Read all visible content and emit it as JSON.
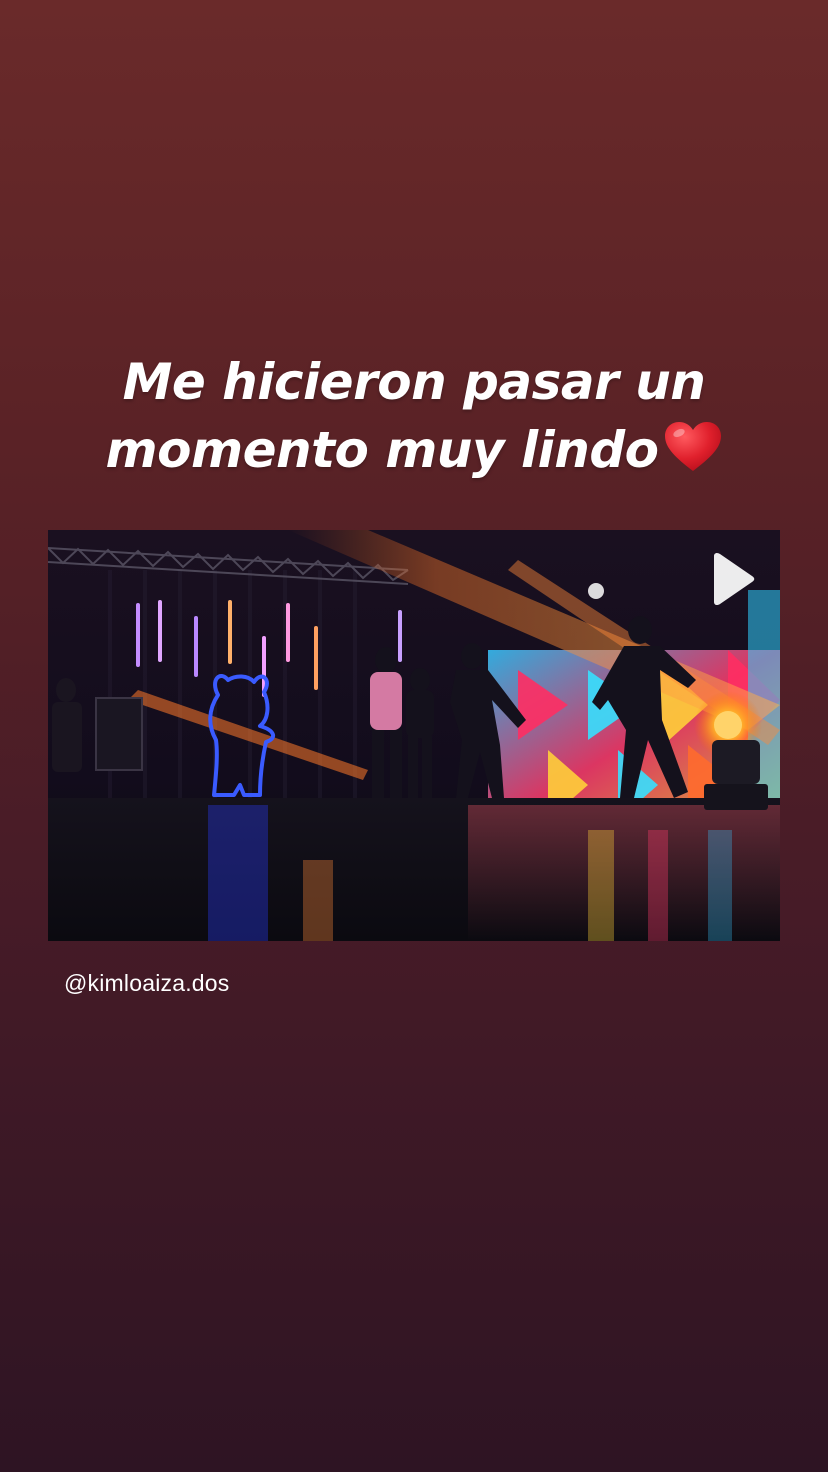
{
  "story": {
    "caption_line_1": "Me hicieron pasar un",
    "caption_line_2": "momento muy lindo",
    "caption_emoji": "red-heart-emoji",
    "mention": "@kimloaiza.dos",
    "shared_post": {
      "media_type": "video",
      "play_icon": "play-icon"
    }
  },
  "colors": {
    "background_top": "#6a2a2a",
    "background_bottom": "#2e1423",
    "heart": "#e0202c",
    "caption_text": "#ffffff"
  }
}
